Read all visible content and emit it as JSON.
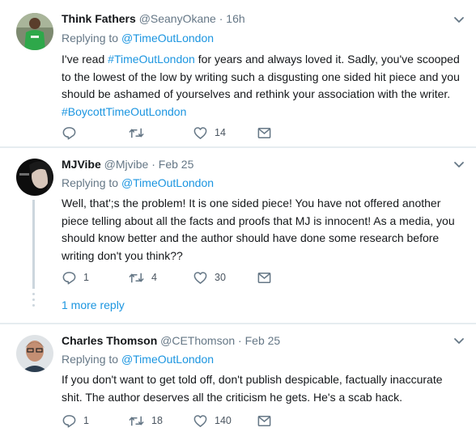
{
  "tweets": [
    {
      "name": "Think Fathers",
      "handle": "@SeanyOkane",
      "time": "16h",
      "replying_prefix": "Replying to ",
      "replying_to": "@TimeOutLondon",
      "body_lines": [
        "I've read #TimeOutLondon for years and always loved it. Sadly, you've scooped",
        "to the lowest of the low by writing such a disgusting one sided hit piece and you",
        "should be ashamed of yourselves and rethink your association with the writer.",
        "#BoycottTimeOutLondon"
      ],
      "reply_count": "",
      "retweet_count": "",
      "like_count": "14"
    },
    {
      "name": "MJVibe",
      "handle": "@Mjvibe",
      "time": "Feb 25",
      "replying_prefix": "Replying to ",
      "replying_to": "@TimeOutLondon",
      "body_lines": [
        "Well, that';s the problem! It is one sided piece! You have not offered another",
        "piece telling about all the facts and proofs that MJ is innocent! As a media, you",
        "should know better and the author should have done some research before",
        "writing don't you think??"
      ],
      "reply_count": "1",
      "retweet_count": "4",
      "like_count": "30",
      "more_replies": "1 more reply"
    },
    {
      "name": "Charles Thomson",
      "handle": "@CEThomson",
      "time": "Feb 25",
      "replying_prefix": "Replying to ",
      "replying_to": "@TimeOutLondon",
      "body_lines": [
        "If you don't want to get told off, don't publish despicable, factually inaccurate",
        "shit. The author deserves all the criticism he gets. He's a scab hack."
      ],
      "reply_count": "1",
      "retweet_count": "18",
      "like_count": "140"
    }
  ],
  "separator": " · ",
  "icons": {
    "reply": "reply-icon",
    "retweet": "retweet-icon",
    "like": "heart-icon",
    "dm": "envelope-icon",
    "more": "chevron-down-icon"
  },
  "colors": {
    "link": "#1b95e0",
    "muted": "#657786",
    "background": "#e6ecf0"
  }
}
